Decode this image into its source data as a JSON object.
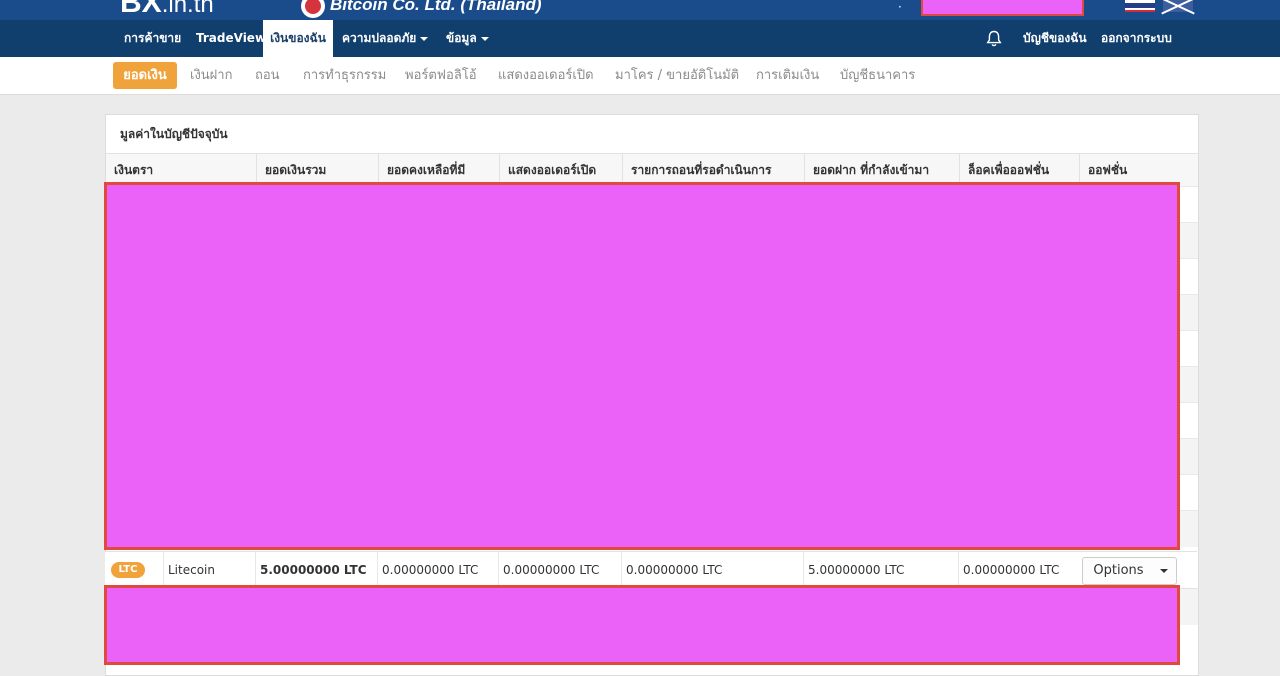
{
  "header": {
    "logo_main": "BX",
    "logo_suffix": ".in.th",
    "brand": "Bitcoin Co. Ltd. (Thailand)",
    "flags": [
      "flag-thailand-icon",
      "flag-uk-icon"
    ]
  },
  "nav": {
    "items": [
      {
        "label": "การค้าขาย",
        "has_caret": false
      },
      {
        "label": "TradeView",
        "has_caret": false
      },
      {
        "label": "เงินของฉัน",
        "has_caret": false,
        "active": true
      },
      {
        "label": "ความปลอดภัย",
        "has_caret": true
      },
      {
        "label": "ข้อมูล",
        "has_caret": true
      }
    ],
    "right": {
      "notification_icon": "bell-icon",
      "account": "บัญชีของฉัน",
      "logout": "ออกจากระบบ"
    }
  },
  "subnav": {
    "items": [
      {
        "label": "ยอดเงิน",
        "active": true
      },
      {
        "label": "เงินฝาก"
      },
      {
        "label": "ถอน"
      },
      {
        "label": "การทำธุรกรรม"
      },
      {
        "label": "พอร์ตฟอลิโอ้"
      },
      {
        "label": "แสดงออเดอร์เปิด"
      },
      {
        "label": "มาโคร / ขายอัติโนมัติ"
      },
      {
        "label": "การเติมเงิน"
      },
      {
        "label": "บัญชีธนาคาร"
      }
    ]
  },
  "panel": {
    "title": "มูลค่าในบัญชีปัจจุบัน",
    "columns": [
      "เงินตรา",
      "ยอดเงินรวม",
      "ยอดคงเหลือที่มี",
      "แสดงออเดอร์เปิด",
      "รายการถอนที่รอดำเนินการ",
      "ยอดฝาก ที่กำลังเข้ามา",
      "ล็อคเพื่อออฟชั่น",
      "ออฟชั่น"
    ],
    "row": {
      "badge": "LTC",
      "name": "Litecoin",
      "total": "5.00000000 LTC",
      "available": "0.00000000 LTC",
      "open_orders": "0.00000000 LTC",
      "pending_withdrawals": "0.00000000 LTC",
      "incoming_deposits": "5.00000000 LTC",
      "locked_options": "0.00000000 LTC",
      "options_label": "Options"
    }
  },
  "colors": {
    "header_blue": "#1a4c8c",
    "nav_blue": "#103f6e",
    "accent_orange": "#f0a23b",
    "redaction": "#ea62f8"
  }
}
